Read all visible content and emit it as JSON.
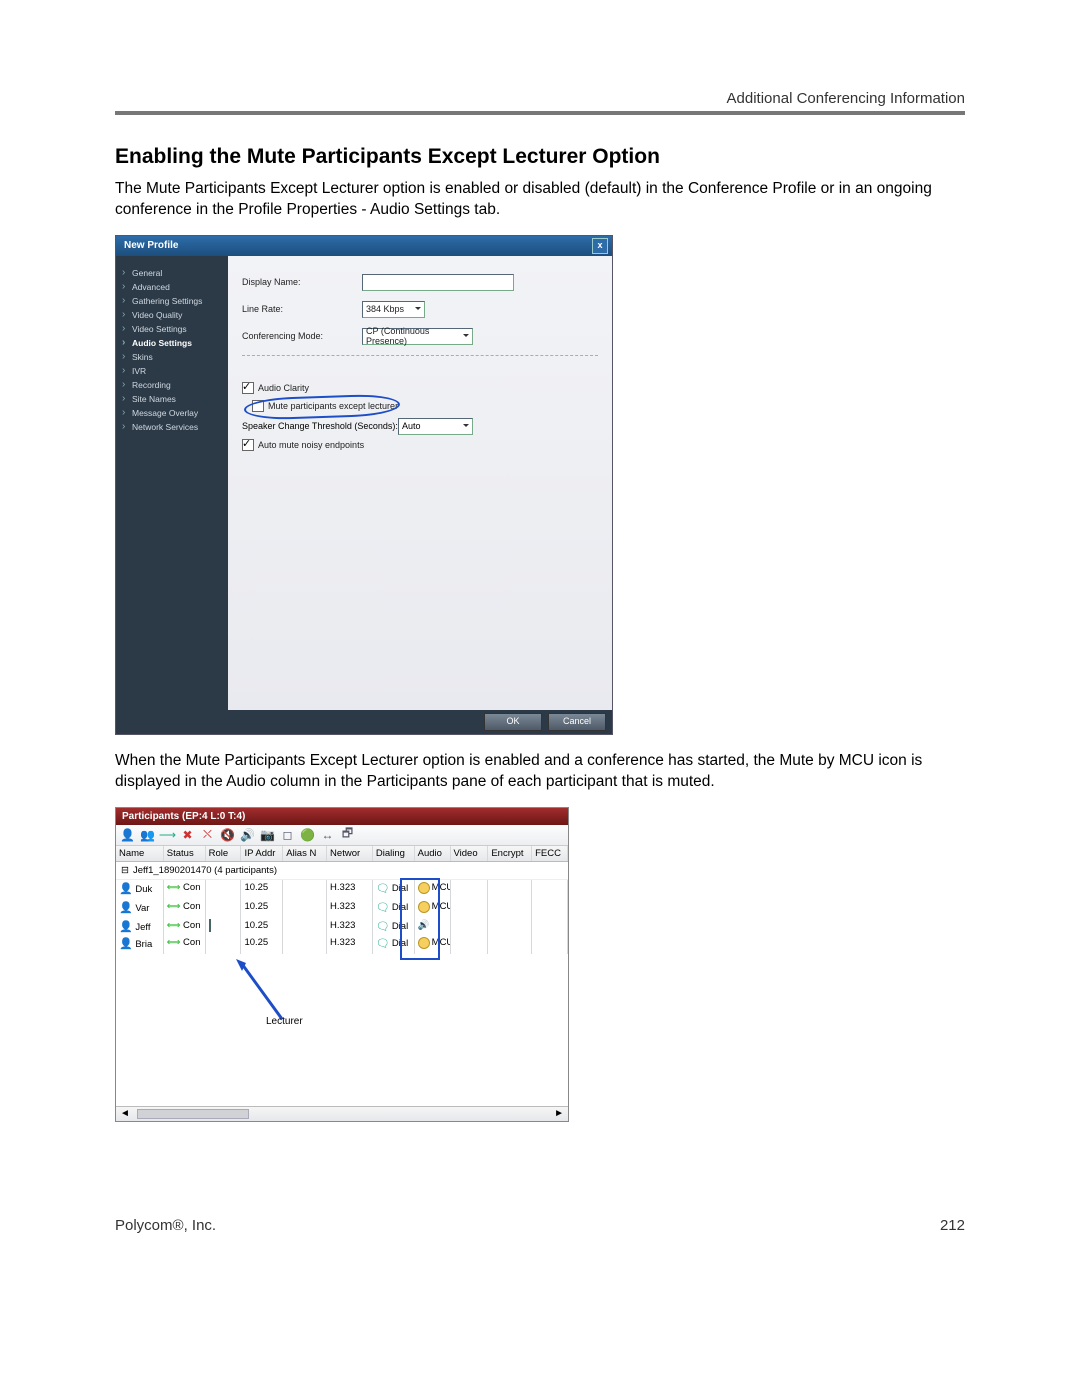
{
  "header": "Additional Conferencing Information",
  "heading": "Enabling the Mute Participants Except Lecturer Option",
  "para1": "The Mute Participants Except Lecturer option is enabled or disabled (default) in the Conference Profile or in an ongoing conference in the Profile Properties - Audio Settings tab.",
  "para2": "When the Mute Participants Except Lecturer option is enabled and a conference has started, the Mute by MCU icon is displayed in the Audio column in the Participants pane of each participant that is muted.",
  "dialog": {
    "title": "New Profile",
    "nav": [
      "General",
      "Advanced",
      "Gathering Settings",
      "Video Quality",
      "Video Settings",
      "Audio Settings",
      "Skins",
      "IVR",
      "Recording",
      "Site Names",
      "Message Overlay",
      "Network Services"
    ],
    "active": "Audio Settings",
    "fields": {
      "display_name_lbl": "Display Name:",
      "line_rate_lbl": "Line Rate:",
      "line_rate_val": "384 Kbps",
      "conf_mode_lbl": "Conferencing Mode:",
      "conf_mode_val": "CP (Continuous Presence)",
      "audio_clarity": "Audio Clarity",
      "mute_except": "Mute participants except lecturer",
      "thresh_lbl": "Speaker Change Threshold (Seconds):",
      "thresh_val": "Auto",
      "auto_mute": "Auto mute noisy endpoints"
    },
    "buttons": {
      "ok": "OK",
      "cancel": "Cancel"
    }
  },
  "pane": {
    "title": "Participants (EP:4 L:0 T:4)",
    "cols": [
      "Name",
      "Status",
      "Role",
      "IP Addr",
      "Alias N",
      "Networ",
      "Dialing",
      "Audio",
      "Video",
      "Encrypt",
      "FECC "
    ],
    "group": "Jeff1_1890201470 (4  participants)",
    "rows": [
      {
        "name": "Duk",
        "status": "Con",
        "role": "",
        "ip": "10.25",
        "alias": "",
        "net": "H.323",
        "dial": "Dial",
        "audio": "MCU",
        "lecturer": false
      },
      {
        "name": "Var",
        "status": "Con",
        "role": "",
        "ip": "10.25",
        "alias": "",
        "net": "H.323",
        "dial": "Dial",
        "audio": "MCU",
        "lecturer": false
      },
      {
        "name": "Jeff",
        "status": "Con",
        "role": "L",
        "ip": "10.25",
        "alias": "",
        "net": "H.323",
        "dial": "Dial",
        "audio": "",
        "lecturer": true
      },
      {
        "name": "Bria",
        "status": "Con",
        "role": "",
        "ip": "10.25",
        "alias": "",
        "net": "H.323",
        "dial": "Dial",
        "audio": "MCU",
        "lecturer": false
      }
    ],
    "annotation": "Lecturer"
  },
  "footer": {
    "left": "Polycom®, Inc.",
    "right": "212"
  }
}
